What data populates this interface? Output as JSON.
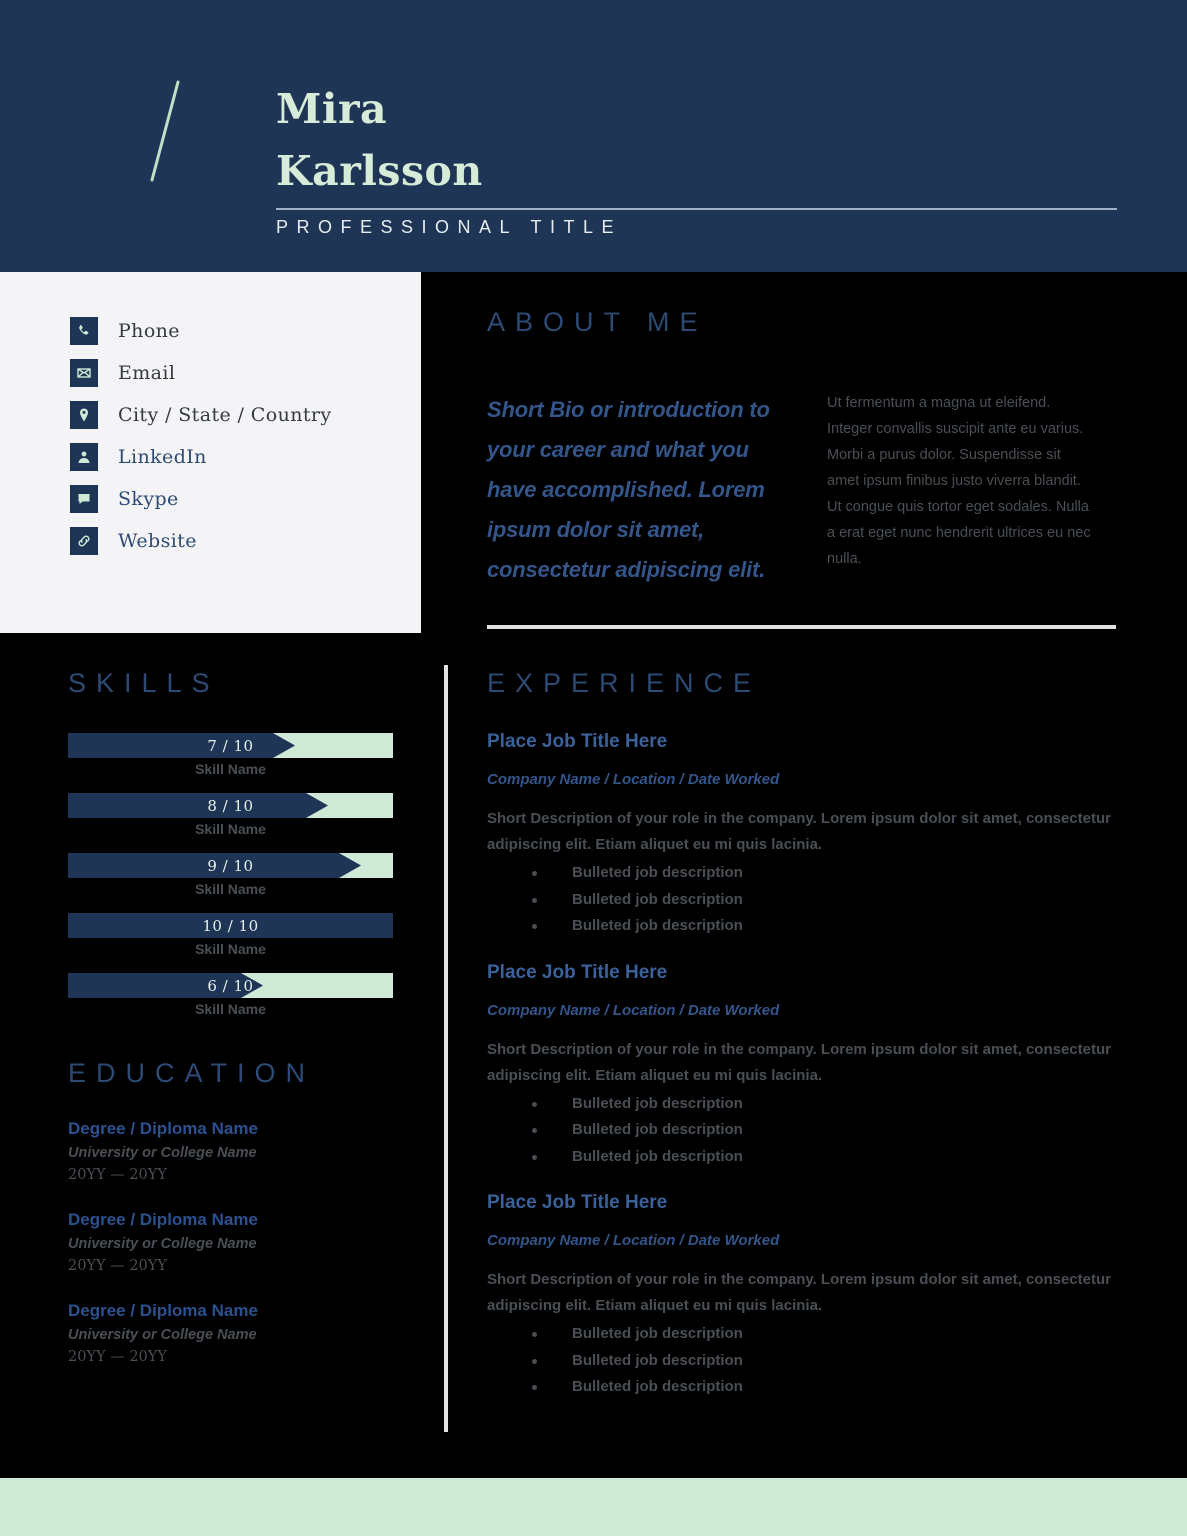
{
  "header": {
    "first_name": "Mira",
    "last_name": "Karlsson",
    "professional_title": "PROFESSIONAL TITLE",
    "slash_icon": "diagonal-slash-icon",
    "bg_color": "#1e3556",
    "accent_color": "#cfe9d6"
  },
  "contact": {
    "items": [
      {
        "icon": "phone-icon",
        "label": "Phone",
        "style": "dark"
      },
      {
        "icon": "envelope-icon",
        "label": "Email",
        "style": "dark"
      },
      {
        "icon": "location-pin-icon",
        "label": "City / State / Country",
        "style": "dark"
      },
      {
        "icon": "linkedin-person-icon",
        "label": "LinkedIn",
        "style": "blue"
      },
      {
        "icon": "skype-chat-icon",
        "label": "Skype",
        "style": "blue"
      },
      {
        "icon": "link-chain-icon",
        "label": "Website",
        "style": "blue"
      }
    ]
  },
  "about": {
    "heading": "ABOUT ME",
    "bio": "Short Bio or introduction to your career and what you have accomplished. Lorem ipsum dolor sit amet, consectetur adipiscing elit.",
    "lorem": "Ut fermentum a magna ut eleifend. Integer convallis suscipit ante eu varius. Morbi a purus dolor. Suspendisse sit amet ipsum finibus justo viverra blandit. Ut congue quis tortor eget sodales. Nulla a erat eget nunc hendrerit ultrices eu nec nulla."
  },
  "skills": {
    "heading": "SKILLS",
    "items": [
      {
        "name": "Skill Name",
        "value": 7,
        "max": 10,
        "value_label": "7 / 10"
      },
      {
        "name": "Skill Name",
        "value": 8,
        "max": 10,
        "value_label": "8 / 10"
      },
      {
        "name": "Skill Name",
        "value": 9,
        "max": 10,
        "value_label": "9 / 10"
      },
      {
        "name": "Skill Name",
        "value": 10,
        "max": 10,
        "value_label": "10 / 10"
      },
      {
        "name": "Skill Name",
        "value": 6,
        "max": 10,
        "value_label": "6 / 10"
      }
    ]
  },
  "education": {
    "heading": "EDUCATION",
    "items": [
      {
        "degree": "Degree / Diploma Name",
        "school": "University or College Name",
        "years": "20YY — 20YY"
      },
      {
        "degree": "Degree / Diploma Name",
        "school": "University or College Name",
        "years": "20YY — 20YY"
      },
      {
        "degree": "Degree / Diploma Name",
        "school": "University or College Name",
        "years": "20YY — 20YY"
      }
    ]
  },
  "experience": {
    "heading": "EXPERIENCE",
    "items": [
      {
        "title": "Place Job Title Here",
        "meta": "Company Name / Location / Date Worked",
        "description": "Short Description of your role in the company. Lorem ipsum dolor sit amet, consectetur adipiscing elit. Etiam aliquet eu mi quis lacinia.",
        "bullets": [
          "Bulleted job description",
          "Bulleted job description",
          "Bulleted job description"
        ]
      },
      {
        "title": "Place Job Title Here",
        "meta": "Company Name / Location / Date Worked",
        "description": "Short Description of your role in the company. Lorem ipsum dolor sit amet, consectetur adipiscing elit. Etiam aliquet eu mi quis lacinia.",
        "bullets": [
          "Bulleted job description",
          "Bulleted job description",
          "Bulleted job description"
        ]
      },
      {
        "title": "Place Job Title Here",
        "meta": "Company Name / Location / Date Worked",
        "description": "Short Description of your role in the company. Lorem ipsum dolor sit amet, consectetur adipiscing elit. Etiam aliquet eu mi quis lacinia.",
        "bullets": [
          "Bulleted job description",
          "Bulleted job description",
          "Bulleted job description"
        ]
      }
    ]
  },
  "chart_data": {
    "type": "bar",
    "title": "SKILLS",
    "categories": [
      "Skill Name",
      "Skill Name",
      "Skill Name",
      "Skill Name",
      "Skill Name"
    ],
    "values": [
      7,
      8,
      9,
      10,
      6
    ],
    "value_labels": [
      "7 / 10",
      "8 / 10",
      "9 / 10",
      "10 / 10",
      "6 / 10"
    ],
    "xlabel": "",
    "ylabel": "",
    "xlim": [
      0,
      10
    ],
    "orientation": "horizontal",
    "grid": false,
    "legend": false,
    "bar_color": "#1e3556",
    "track_color": "#cfe9d6"
  }
}
